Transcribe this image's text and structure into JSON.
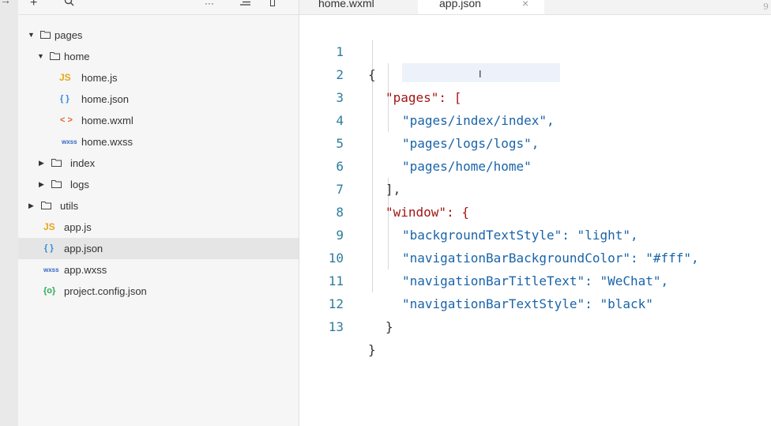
{
  "toolbar": {
    "add_icon": "plus-icon",
    "search_icon": "search-icon",
    "more_label": "···",
    "collapse_icon": "collapse-icon",
    "layout_icon": "layout-icon"
  },
  "tree": {
    "items": [
      {
        "label": "pages",
        "type": "folder",
        "expanded": true
      },
      {
        "label": "home",
        "type": "folder",
        "expanded": true
      },
      {
        "label": "home.js",
        "type": "js",
        "icon_text": "JS"
      },
      {
        "label": "home.json",
        "type": "json",
        "icon_text": "{ }"
      },
      {
        "label": "home.wxml",
        "type": "wxml",
        "icon_text": "< >"
      },
      {
        "label": "home.wxss",
        "type": "wxss",
        "icon_text": "wxss"
      },
      {
        "label": "index",
        "type": "folder",
        "expanded": false
      },
      {
        "label": "logs",
        "type": "folder",
        "expanded": false
      },
      {
        "label": "utils",
        "type": "folder",
        "expanded": false
      },
      {
        "label": "app.js",
        "type": "js",
        "icon_text": "JS"
      },
      {
        "label": "app.json",
        "type": "json",
        "icon_text": "{ }",
        "selected": true
      },
      {
        "label": "app.wxss",
        "type": "wxss",
        "icon_text": "wxss"
      },
      {
        "label": "project.config.json",
        "type": "config",
        "icon_text": "{o}"
      }
    ]
  },
  "tabs": [
    {
      "label": "home.wxml",
      "active": false
    },
    {
      "label": "app.json",
      "active": true,
      "close": "×"
    }
  ],
  "editor": {
    "lines": [
      {
        "num": "1",
        "text": "{"
      },
      {
        "num": "2",
        "text": "\"pages\": ["
      },
      {
        "num": "3",
        "text": "\"pages/index/index\","
      },
      {
        "num": "4",
        "text": "\"pages/logs/logs\","
      },
      {
        "num": "5",
        "text": "\"pages/home/home\""
      },
      {
        "num": "6",
        "text": "],"
      },
      {
        "num": "7",
        "text": "\"window\": {"
      },
      {
        "num": "8",
        "text": "\"backgroundTextStyle\": \"light\","
      },
      {
        "num": "9",
        "text": "\"navigationBarBackgroundColor\": \"#fff\","
      },
      {
        "num": "10",
        "text": "\"navigationBarTitleText\": \"WeChat\","
      },
      {
        "num": "11",
        "text": "\"navigationBarTextStyle\": \"black\""
      },
      {
        "num": "12",
        "text": "}"
      },
      {
        "num": "13",
        "text": "}"
      }
    ]
  },
  "corner_text": "9",
  "colors": {
    "line_number": "#2e7d9a",
    "string": "#1a64a8",
    "selected_row": "#e5e5e5"
  }
}
